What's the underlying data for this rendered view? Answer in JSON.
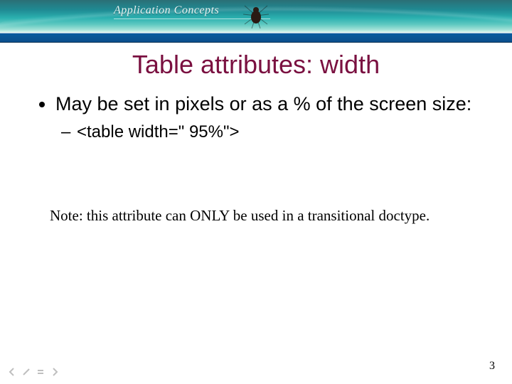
{
  "header": {
    "brand": "Application Concepts"
  },
  "slide": {
    "title": "Table attributes: width",
    "bullets": [
      {
        "text": "May be set in pixels or as a % of the screen size:",
        "sub": [
          "<table width=\" 95%\">"
        ]
      }
    ],
    "note": "Note: this attribute can ONLY be used in a transitional doctype.",
    "page_number": "3"
  },
  "nav": {
    "prev": "prev",
    "pen": "pen",
    "menu": "menu",
    "next": "next"
  }
}
